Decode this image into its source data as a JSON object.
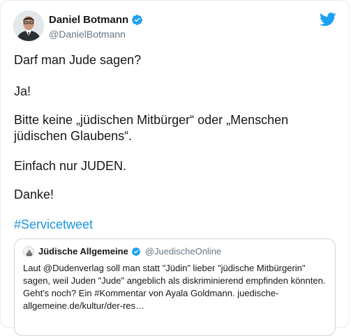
{
  "author": {
    "display_name": "Daniel Botmann",
    "handle": "@DanielBotmann",
    "verified": true
  },
  "tweet": {
    "lines": [
      "Darf man Jude sagen?",
      "Ja!",
      "Bitte keine „jüdischen Mitbürger“ oder „Menschen",
      "jüdischen Glaubens“.",
      "Einfach nur JUDEN.",
      "Danke!"
    ],
    "hashtag": "#Servicetweet"
  },
  "quoted_tweet": {
    "display_name": "Jüdische Allgemeine",
    "handle": "@JuedischeOnline",
    "verified": true,
    "lines": [
      "Laut @Dudenverlag soll man statt \"Jüdin\" lieber \"jüdische Mitbürgerin\"",
      "sagen, weil Juden \"Jude\" angeblich als diskriminierend empfinden könnten.",
      "Geht's noch? Ein #Kommentar von Ayala Goldmann. juedische-",
      "allgemeine.de/kultur/der-res…"
    ]
  },
  "colors": {
    "text": "#14171a",
    "secondary": "#657786",
    "link": "#1b95e0",
    "twitter_blue": "#1da1f2",
    "border": "#e6ecf0"
  },
  "icons": {
    "brand": "twitter-bird-icon",
    "verified": "verified-badge-icon"
  }
}
